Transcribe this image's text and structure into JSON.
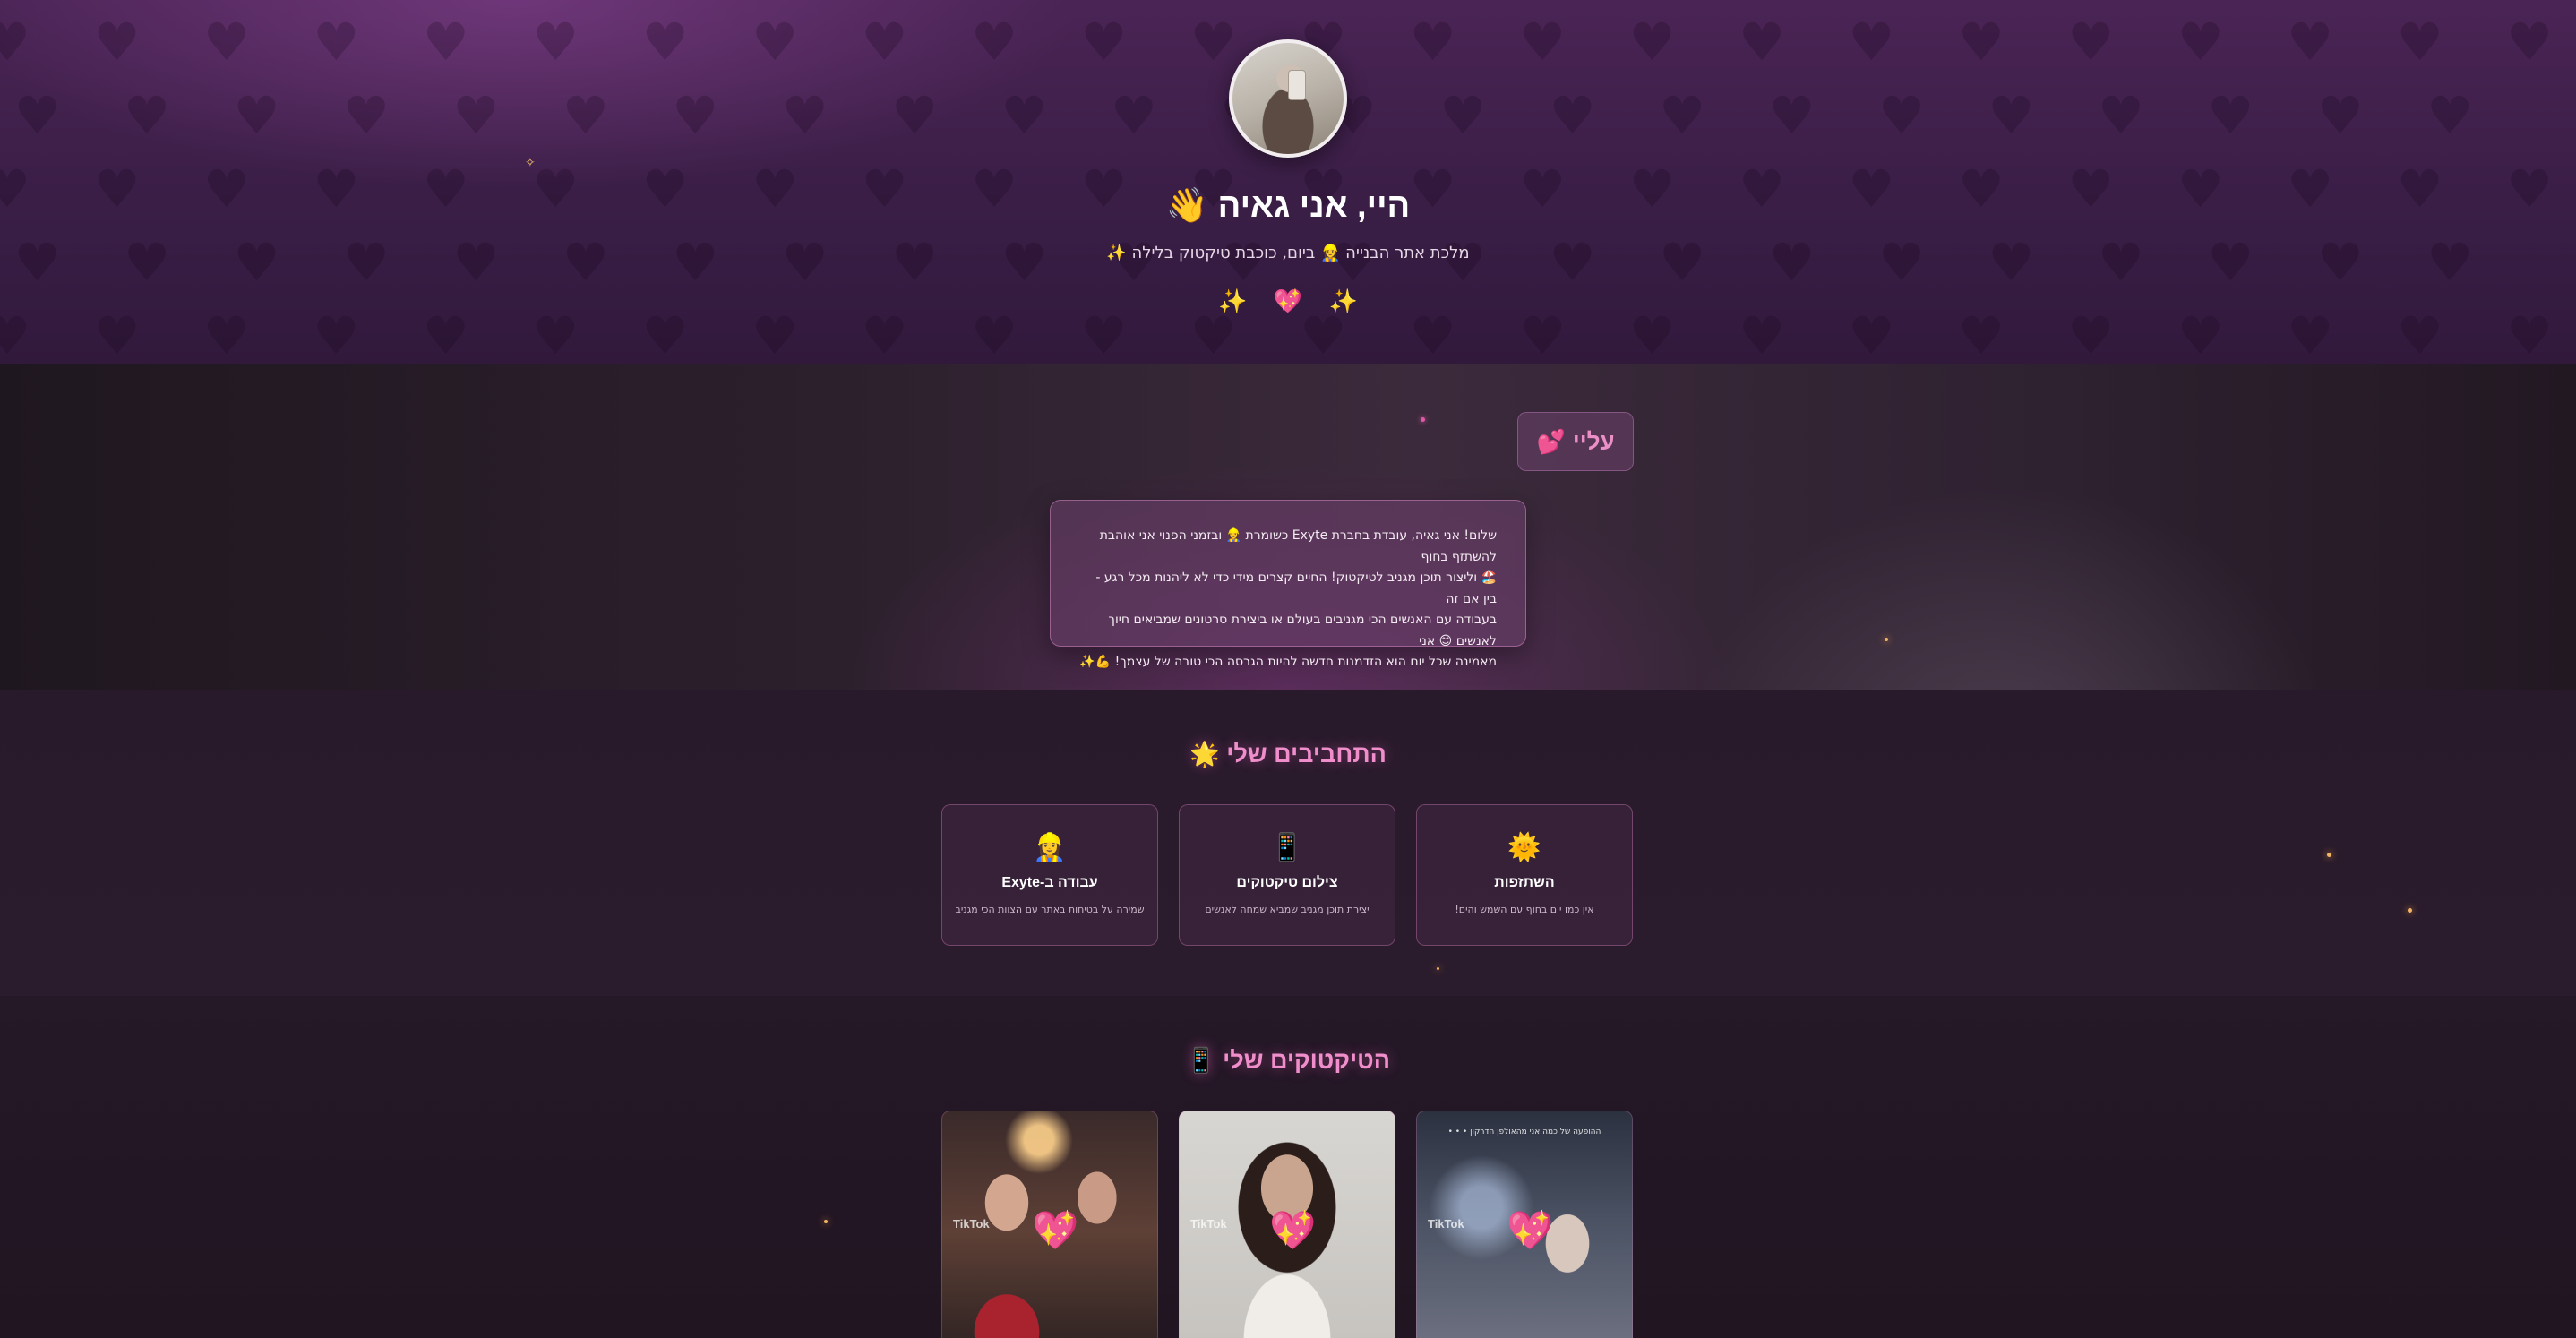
{
  "hero": {
    "title": "היי, אני גאיה",
    "title_emoji": "👋",
    "subtitle": "מלכת אתר הבנייה 👷‍♀️ ביום, כוכבת טיקטוק בלילה ✨",
    "icons": [
      "✨",
      "💖",
      "✨"
    ],
    "pattern_glyph": "♥"
  },
  "about": {
    "title": "עליי",
    "title_emoji": "💕",
    "lines": [
      "שלום! אני גאיה, עובדת בחברת Exyte כשומרת 👷‍♀️ ובזמני הפנוי אני אוהבת להשתזף בחוף",
      "🏖️ וליצור תוכן מגניב לטיקטוק! החיים קצרים מידי כדי לא ליהנות מכל רגע - בין אם זה",
      "בעבודה עם האנשים הכי מגניבים בעולם או ביצירת סרטונים שמביאים חיוך לאנשים 😊 אני",
      "מאמינה שכל יום הוא הזדמנות חדשה להיות הגרסה הכי טובה של עצמך! 💪✨"
    ]
  },
  "hobbies": {
    "title": "התחביבים שלי",
    "title_emoji": "🌟",
    "items": [
      {
        "emoji": "🌞",
        "name": "השתזפות",
        "desc": "אין כמו יום בחוף עם השמש והים!"
      },
      {
        "emoji": "📱",
        "name": "צילום טיקטוקים",
        "desc": "יצירת תוכן מגניב שמביא שמחה לאנשים"
      },
      {
        "emoji": "👷‍♀️",
        "name": "עבודה ב-Exyte",
        "desc": "שמירה על בטיחות באתר עם הצוות הכי מגניב"
      }
    ]
  },
  "tiktoks": {
    "title": "הטיקטוקים שלי",
    "title_emoji": "📱",
    "watermark": "TikTok",
    "overlay_emoji": "💖",
    "videos": [
      {
        "caption": "ההופעה של כמה אני מהאולפן הדרקון • • •"
      },
      {
        "caption": ""
      },
      {
        "caption": ""
      }
    ]
  },
  "colors": {
    "accent_pink": "#f08dcb",
    "hero_bg": "#3a1e46",
    "page_bg": "#241726"
  }
}
